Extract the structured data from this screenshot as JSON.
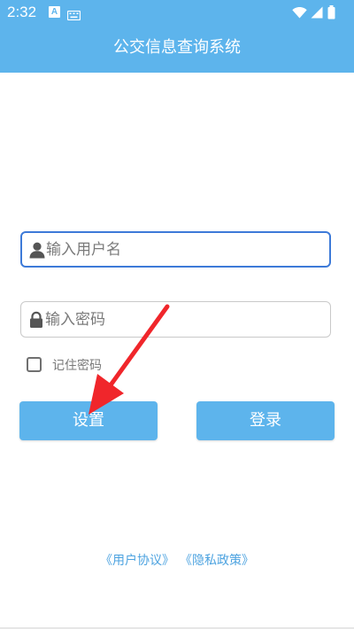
{
  "status_bar": {
    "time": "2:32",
    "notification_icon_letter": "A",
    "icons": [
      "a-notification-icon",
      "keyboard-icon",
      "wifi-icon",
      "signal-icon",
      "battery-icon"
    ]
  },
  "header": {
    "title": "公交信息查询系统",
    "color": "#5db4ec"
  },
  "form": {
    "username": {
      "value": "",
      "placeholder": "输入用户名",
      "icon": "user-icon",
      "focused": true
    },
    "password": {
      "value": "",
      "placeholder": "输入密码",
      "icon": "lock-icon"
    },
    "remember": {
      "label": "记住密码",
      "checked": false
    }
  },
  "buttons": {
    "settings_label": "设置",
    "login_label": "登录",
    "color": "#5db4ec"
  },
  "annotation": {
    "arrow_color": "#f0262b",
    "points_to": "settings-button"
  },
  "footer": {
    "user_agreement": "《用户协议》",
    "privacy_policy": "《隐私政策》",
    "link_color": "#4da3e0"
  }
}
